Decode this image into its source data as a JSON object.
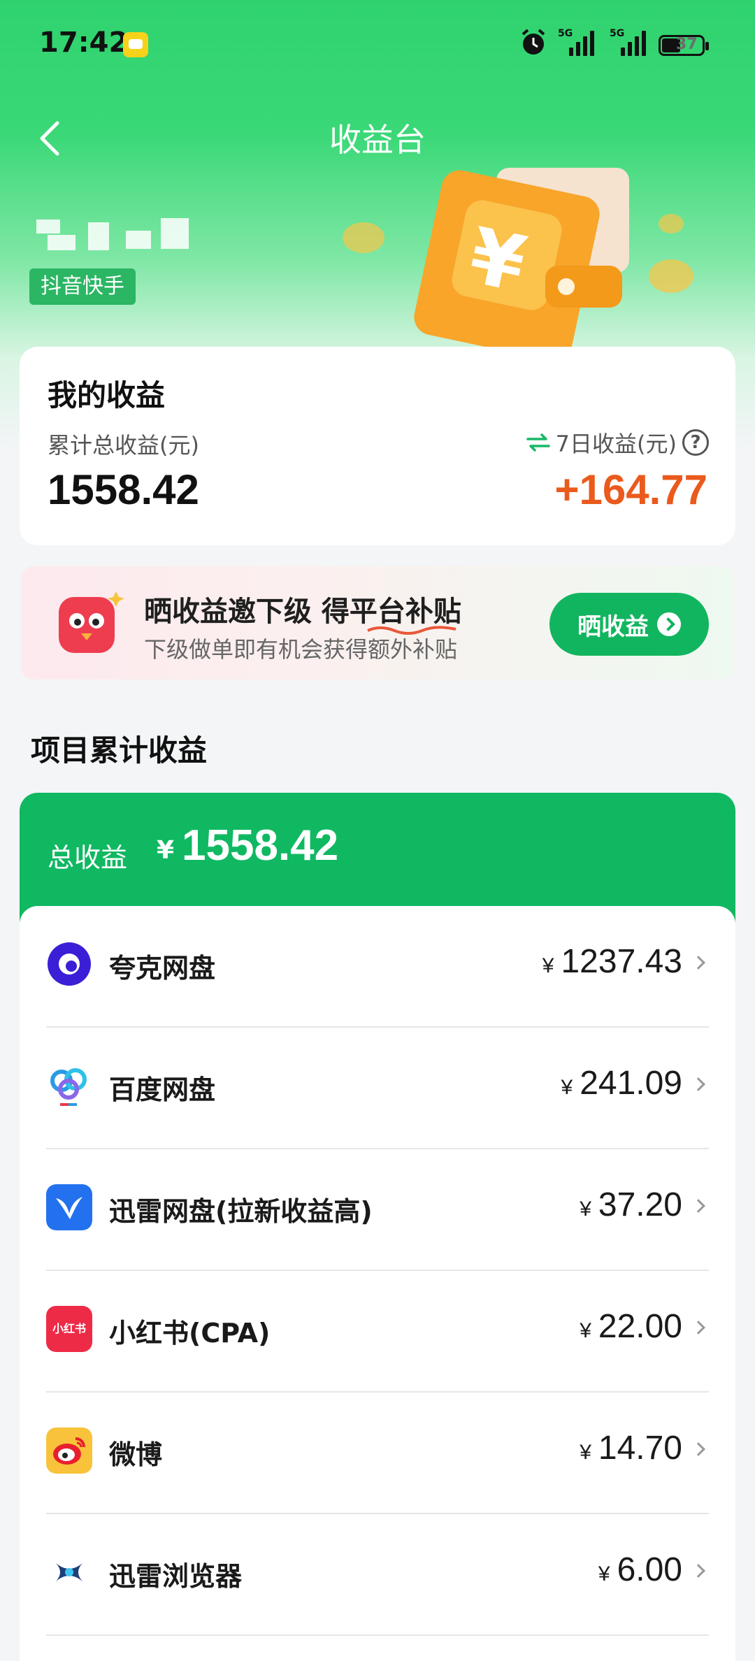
{
  "status_bar": {
    "time": "17:42",
    "battery": "37",
    "sig1": "5G",
    "sig2": "5G"
  },
  "header": {
    "title": "收益台"
  },
  "user": {
    "source_tag": "抖音快手"
  },
  "earnings": {
    "title": "我的收益",
    "total_label": "累计总收益(元)",
    "total_value": "1558.42",
    "week_label": "7日收益(元)",
    "week_value": "+164.77",
    "help_symbol": "?"
  },
  "promo": {
    "title": "晒收益邀下级 得平台补贴",
    "subtitle": "下级做单即有机会获得额外补贴",
    "button": "晒收益"
  },
  "projects": {
    "section_title": "项目累计收益",
    "total_label": "总收益",
    "currency": "¥",
    "total_value": "1558.42",
    "items": [
      {
        "name": "夸克网盘",
        "amount": "1237.43",
        "icon": "quark-icon"
      },
      {
        "name": "百度网盘",
        "amount": "241.09",
        "icon": "baidu-netdisk-icon"
      },
      {
        "name": "迅雷网盘(拉新收益高)",
        "amount": "37.20",
        "icon": "xunlei-netdisk-icon"
      },
      {
        "name": "小红书(CPA)",
        "amount": "22.00",
        "icon": "xiaohongshu-icon",
        "logo_text": "小红书"
      },
      {
        "name": "微博",
        "amount": "14.70",
        "icon": "weibo-icon"
      },
      {
        "name": "迅雷浏览器",
        "amount": "6.00",
        "icon": "xunlei-browser-icon"
      }
    ]
  },
  "colors": {
    "primary": "#10b862",
    "accent_orange": "#ea5a1d"
  }
}
